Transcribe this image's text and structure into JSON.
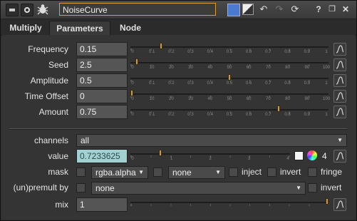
{
  "titlebar": {
    "node_name": "NoiseCurve"
  },
  "tabs": [
    {
      "label": "Multiply"
    },
    {
      "label": "Parameters"
    },
    {
      "label": "Node"
    }
  ],
  "params": [
    {
      "label": "Frequency",
      "value": "0.15",
      "fraction": 0.15,
      "ticks": [
        "0",
        "0.1",
        "0.2",
        "0.3",
        "0.4",
        "0.5",
        "0.6",
        "0.7",
        "0.8",
        "0.9",
        "1"
      ]
    },
    {
      "label": "Seed",
      "value": "2.5",
      "fraction": 0.025,
      "ticks": [
        "0",
        "10",
        "20",
        "30",
        "40",
        "50",
        "60",
        "70",
        "80",
        "90",
        "100"
      ]
    },
    {
      "label": "Amplitude",
      "value": "0.5",
      "fraction": 0.5,
      "ticks": [
        "0",
        "0.1",
        "0.2",
        "0.3",
        "0.4",
        "0.5",
        "0.6",
        "0.7",
        "0.8",
        "0.9",
        "1"
      ]
    },
    {
      "label": "Time Offset",
      "value": "0",
      "fraction": 0.0,
      "ticks": [
        "0",
        "10",
        "20",
        "30",
        "40",
        "50",
        "60",
        "70",
        "80",
        "90",
        "100"
      ]
    },
    {
      "label": "Amount",
      "value": "0.75",
      "fraction": 0.75,
      "ticks": [
        "0",
        "0.1",
        "0.2",
        "0.3",
        "0.4",
        "0.5",
        "0.6",
        "0.7",
        "0.8",
        "0.9",
        "1"
      ]
    }
  ],
  "channels": {
    "label": "channels",
    "value": "all"
  },
  "value_row": {
    "label": "value",
    "value": "0.7233625",
    "fraction": 0.18,
    "ticks": [
      "0",
      "1",
      "2",
      "3",
      "4"
    ],
    "channel_count": "4"
  },
  "mask": {
    "label": "mask",
    "channel": "rgba.alpha",
    "layer": "none",
    "inject": "inject",
    "invert": "invert",
    "fringe": "fringe"
  },
  "premult": {
    "label": "(un)premult by",
    "value": "none",
    "invert": "invert"
  },
  "mix": {
    "label": "mix",
    "value": "1",
    "fraction": 1.0
  },
  "colors": {
    "accent_orange": "#e09a3a",
    "value_highlight": "#a3d1d1",
    "knob": "#c89a4a"
  }
}
